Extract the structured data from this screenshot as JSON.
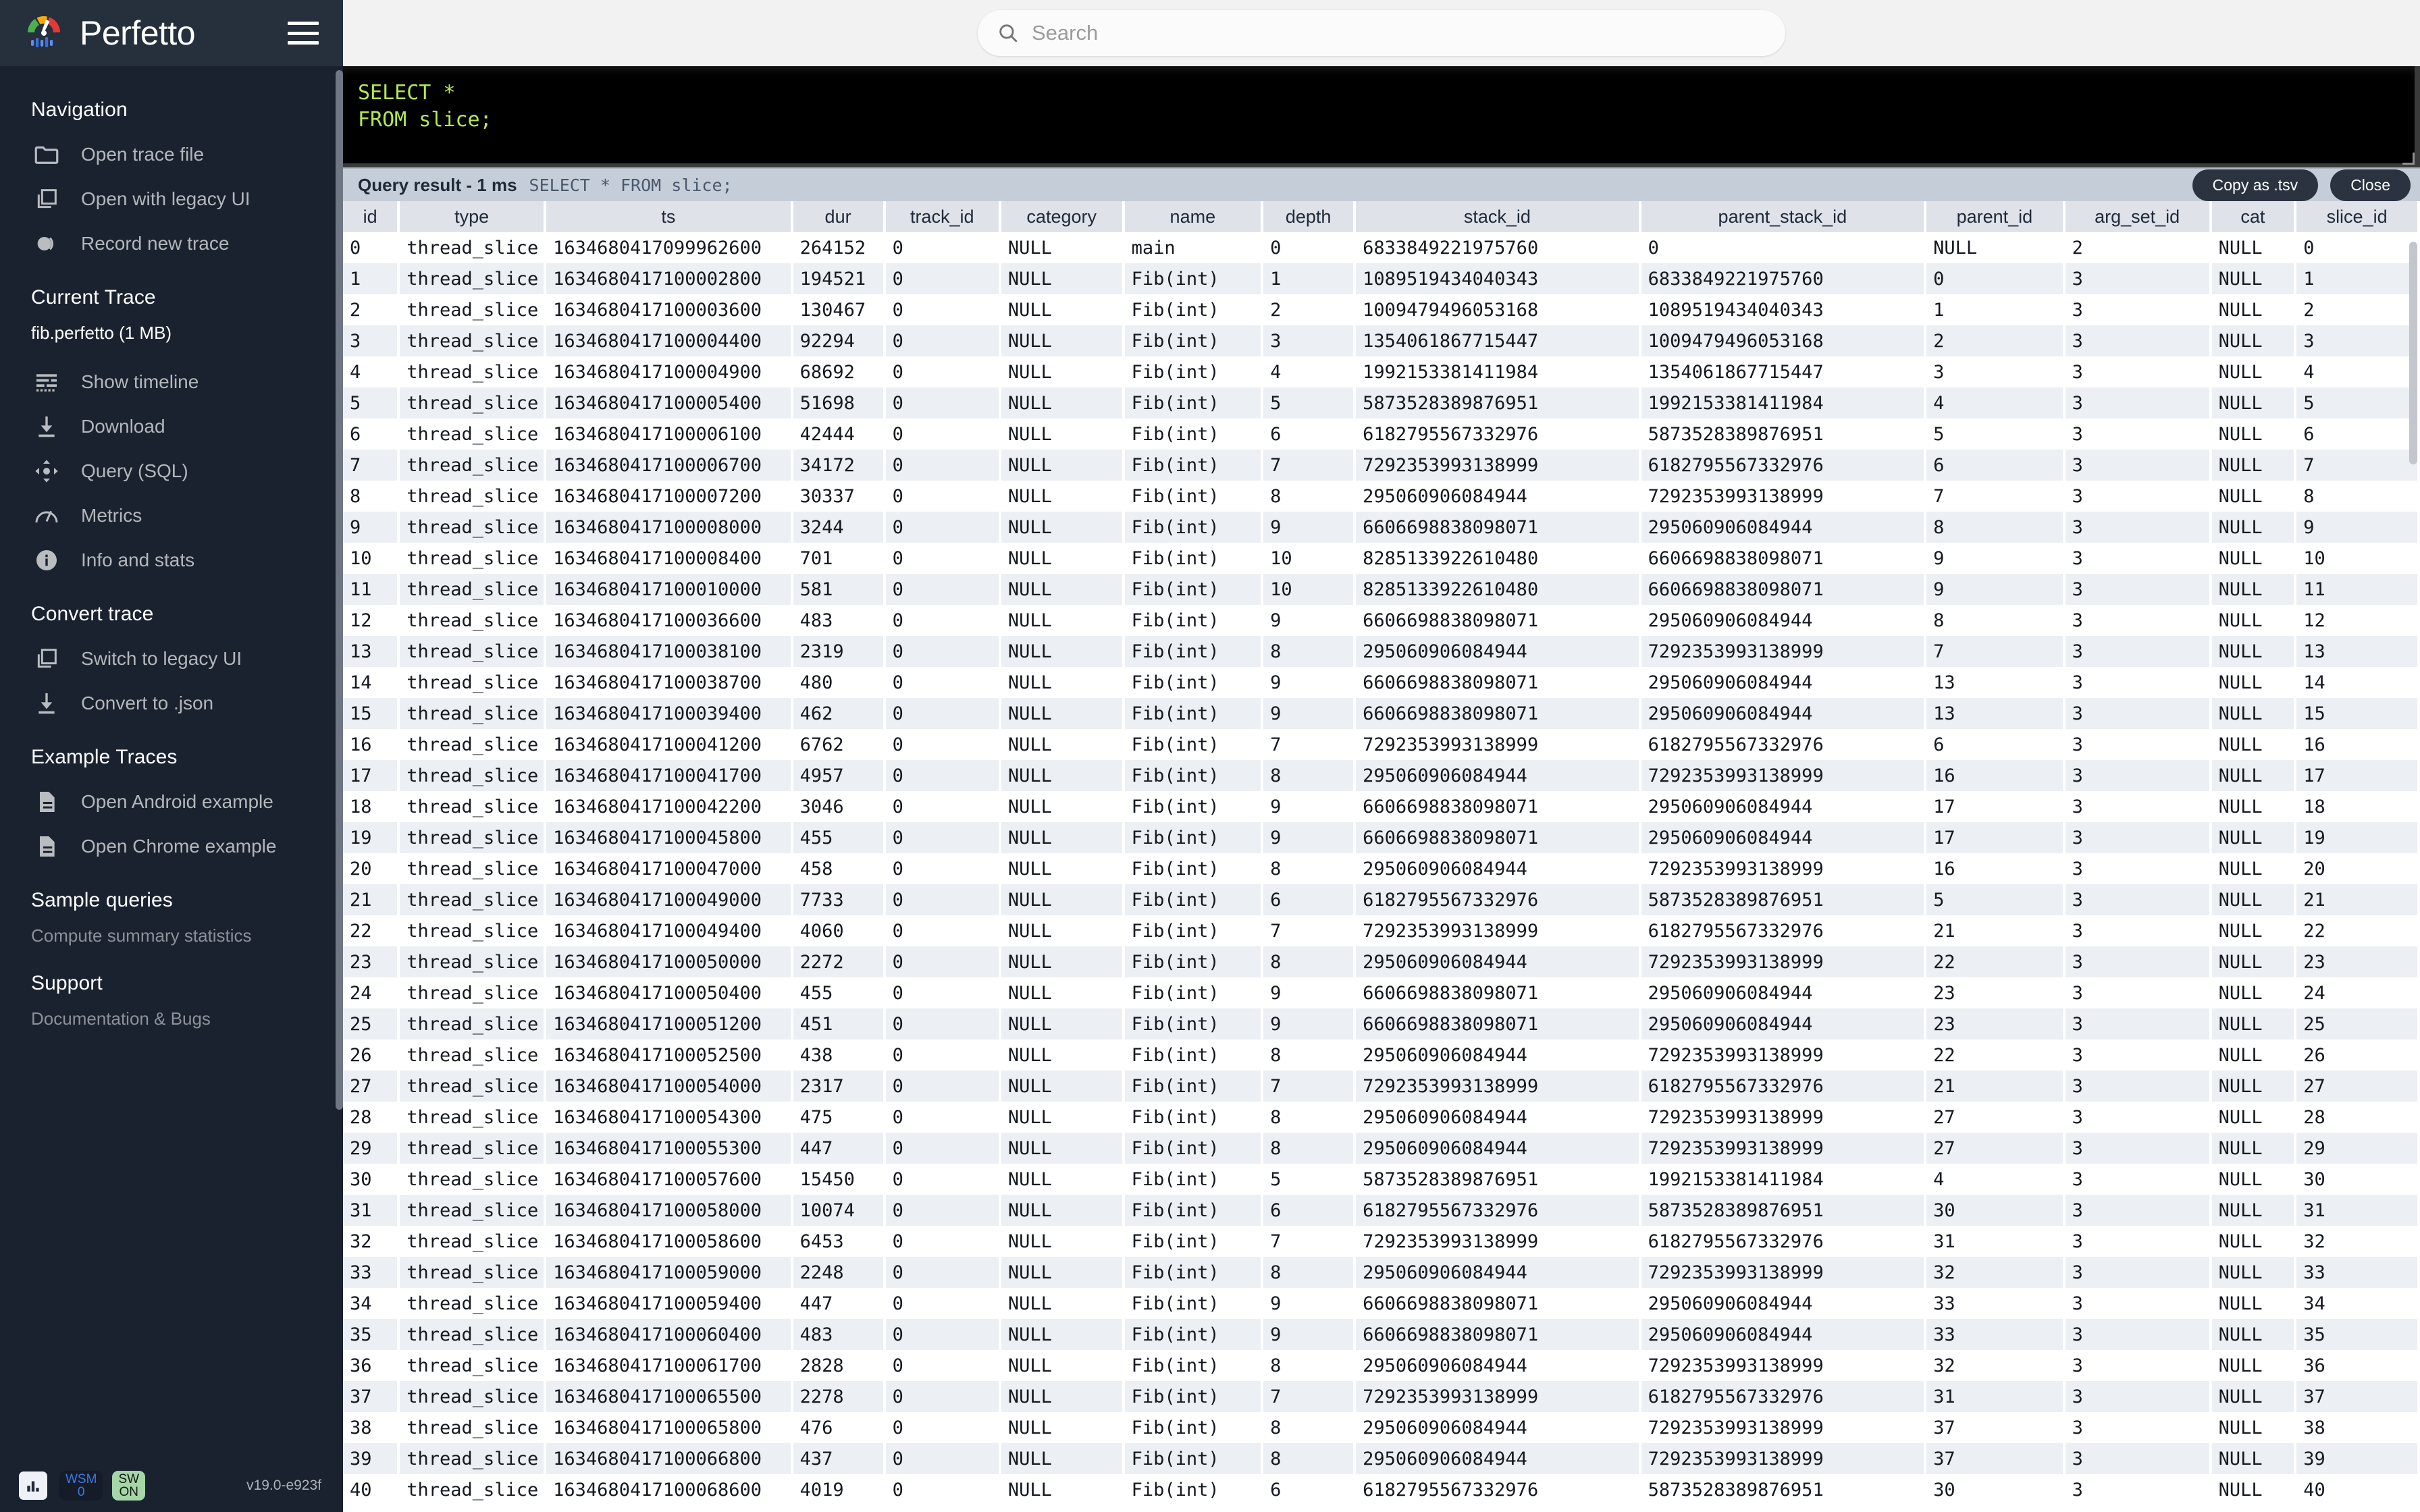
{
  "brand": {
    "title": "Perfetto",
    "logo_icon": "perfetto-logo",
    "menu_icon": "hamburger-icon"
  },
  "search": {
    "placeholder": "Search",
    "value": "",
    "icon": "search-icon"
  },
  "sidebar": {
    "sections": [
      {
        "title": "Navigation",
        "items": [
          {
            "label": "Open trace file",
            "icon": "folder-icon"
          },
          {
            "label": "Open with legacy UI",
            "icon": "copy-icon"
          },
          {
            "label": "Record new trace",
            "icon": "record-icon"
          }
        ]
      },
      {
        "title": "Current Trace",
        "trace_file": "fib.perfetto (1 MB)",
        "items": [
          {
            "label": "Show timeline",
            "icon": "timeline-icon"
          },
          {
            "label": "Download",
            "icon": "download-icon"
          },
          {
            "label": "Query (SQL)",
            "icon": "query-sql-icon"
          },
          {
            "label": "Metrics",
            "icon": "speedometer-icon"
          },
          {
            "label": "Info and stats",
            "icon": "info-icon"
          }
        ]
      },
      {
        "title": "Convert trace",
        "items": [
          {
            "label": "Switch to legacy UI",
            "icon": "copy-icon"
          },
          {
            "label": "Convert to .json",
            "icon": "download-icon"
          }
        ]
      },
      {
        "title": "Example Traces",
        "items": [
          {
            "label": "Open Android example",
            "icon": "document-icon"
          },
          {
            "label": "Open Chrome example",
            "icon": "document-icon"
          }
        ]
      },
      {
        "title": "Sample queries",
        "links": [
          "Compute summary statistics"
        ]
      },
      {
        "title": "Support",
        "links": [
          "Documentation & Bugs"
        ]
      }
    ],
    "footer": {
      "chart_icon": "bar-chart-icon",
      "wsm_label": "WSM",
      "wsm_value": "0",
      "sw_label": "SW",
      "sw_value": "ON",
      "version": "v19.0-e923f"
    }
  },
  "editor": {
    "sql": "SELECT *\nFROM slice;"
  },
  "query_result": {
    "title": "Query result - 1 ms",
    "query": "SELECT * FROM slice;",
    "copy_label": "Copy as .tsv",
    "close_label": "Close"
  },
  "table": {
    "columns": [
      "id",
      "type",
      "ts",
      "dur",
      "track_id",
      "category",
      "name",
      "depth",
      "stack_id",
      "parent_stack_id",
      "parent_id",
      "arg_set_id",
      "cat",
      "slice_id"
    ],
    "rows": [
      [
        "0",
        "thread_slice",
        "1634680417099962600",
        "264152",
        "0",
        "NULL",
        "main",
        "0",
        "6833849221975760",
        "0",
        "NULL",
        "2",
        "NULL",
        "0"
      ],
      [
        "1",
        "thread_slice",
        "1634680417100002800",
        "194521",
        "0",
        "NULL",
        "Fib(int)",
        "1",
        "1089519434040343",
        "6833849221975760",
        "0",
        "3",
        "NULL",
        "1"
      ],
      [
        "2",
        "thread_slice",
        "1634680417100003600",
        "130467",
        "0",
        "NULL",
        "Fib(int)",
        "2",
        "1009479496053168",
        "1089519434040343",
        "1",
        "3",
        "NULL",
        "2"
      ],
      [
        "3",
        "thread_slice",
        "1634680417100004400",
        "92294",
        "0",
        "NULL",
        "Fib(int)",
        "3",
        "1354061867715447",
        "1009479496053168",
        "2",
        "3",
        "NULL",
        "3"
      ],
      [
        "4",
        "thread_slice",
        "1634680417100004900",
        "68692",
        "0",
        "NULL",
        "Fib(int)",
        "4",
        "1992153381411984",
        "1354061867715447",
        "3",
        "3",
        "NULL",
        "4"
      ],
      [
        "5",
        "thread_slice",
        "1634680417100005400",
        "51698",
        "0",
        "NULL",
        "Fib(int)",
        "5",
        "5873528389876951",
        "1992153381411984",
        "4",
        "3",
        "NULL",
        "5"
      ],
      [
        "6",
        "thread_slice",
        "1634680417100006100",
        "42444",
        "0",
        "NULL",
        "Fib(int)",
        "6",
        "6182795567332976",
        "5873528389876951",
        "5",
        "3",
        "NULL",
        "6"
      ],
      [
        "7",
        "thread_slice",
        "1634680417100006700",
        "34172",
        "0",
        "NULL",
        "Fib(int)",
        "7",
        "7292353993138999",
        "6182795567332976",
        "6",
        "3",
        "NULL",
        "7"
      ],
      [
        "8",
        "thread_slice",
        "1634680417100007200",
        "30337",
        "0",
        "NULL",
        "Fib(int)",
        "8",
        "295060906084944",
        "7292353993138999",
        "7",
        "3",
        "NULL",
        "8"
      ],
      [
        "9",
        "thread_slice",
        "1634680417100008000",
        "3244",
        "0",
        "NULL",
        "Fib(int)",
        "9",
        "6606698838098071",
        "295060906084944",
        "8",
        "3",
        "NULL",
        "9"
      ],
      [
        "10",
        "thread_slice",
        "1634680417100008400",
        "701",
        "0",
        "NULL",
        "Fib(int)",
        "10",
        "8285133922610480",
        "6606698838098071",
        "9",
        "3",
        "NULL",
        "10"
      ],
      [
        "11",
        "thread_slice",
        "1634680417100010000",
        "581",
        "0",
        "NULL",
        "Fib(int)",
        "10",
        "8285133922610480",
        "6606698838098071",
        "9",
        "3",
        "NULL",
        "11"
      ],
      [
        "12",
        "thread_slice",
        "1634680417100036600",
        "483",
        "0",
        "NULL",
        "Fib(int)",
        "9",
        "6606698838098071",
        "295060906084944",
        "8",
        "3",
        "NULL",
        "12"
      ],
      [
        "13",
        "thread_slice",
        "1634680417100038100",
        "2319",
        "0",
        "NULL",
        "Fib(int)",
        "8",
        "295060906084944",
        "7292353993138999",
        "7",
        "3",
        "NULL",
        "13"
      ],
      [
        "14",
        "thread_slice",
        "1634680417100038700",
        "480",
        "0",
        "NULL",
        "Fib(int)",
        "9",
        "6606698838098071",
        "295060906084944",
        "13",
        "3",
        "NULL",
        "14"
      ],
      [
        "15",
        "thread_slice",
        "1634680417100039400",
        "462",
        "0",
        "NULL",
        "Fib(int)",
        "9",
        "6606698838098071",
        "295060906084944",
        "13",
        "3",
        "NULL",
        "15"
      ],
      [
        "16",
        "thread_slice",
        "1634680417100041200",
        "6762",
        "0",
        "NULL",
        "Fib(int)",
        "7",
        "7292353993138999",
        "6182795567332976",
        "6",
        "3",
        "NULL",
        "16"
      ],
      [
        "17",
        "thread_slice",
        "1634680417100041700",
        "4957",
        "0",
        "NULL",
        "Fib(int)",
        "8",
        "295060906084944",
        "7292353993138999",
        "16",
        "3",
        "NULL",
        "17"
      ],
      [
        "18",
        "thread_slice",
        "1634680417100042200",
        "3046",
        "0",
        "NULL",
        "Fib(int)",
        "9",
        "6606698838098071",
        "295060906084944",
        "17",
        "3",
        "NULL",
        "18"
      ],
      [
        "19",
        "thread_slice",
        "1634680417100045800",
        "455",
        "0",
        "NULL",
        "Fib(int)",
        "9",
        "6606698838098071",
        "295060906084944",
        "17",
        "3",
        "NULL",
        "19"
      ],
      [
        "20",
        "thread_slice",
        "1634680417100047000",
        "458",
        "0",
        "NULL",
        "Fib(int)",
        "8",
        "295060906084944",
        "7292353993138999",
        "16",
        "3",
        "NULL",
        "20"
      ],
      [
        "21",
        "thread_slice",
        "1634680417100049000",
        "7733",
        "0",
        "NULL",
        "Fib(int)",
        "6",
        "6182795567332976",
        "5873528389876951",
        "5",
        "3",
        "NULL",
        "21"
      ],
      [
        "22",
        "thread_slice",
        "1634680417100049400",
        "4060",
        "0",
        "NULL",
        "Fib(int)",
        "7",
        "7292353993138999",
        "6182795567332976",
        "21",
        "3",
        "NULL",
        "22"
      ],
      [
        "23",
        "thread_slice",
        "1634680417100050000",
        "2272",
        "0",
        "NULL",
        "Fib(int)",
        "8",
        "295060906084944",
        "7292353993138999",
        "22",
        "3",
        "NULL",
        "23"
      ],
      [
        "24",
        "thread_slice",
        "1634680417100050400",
        "455",
        "0",
        "NULL",
        "Fib(int)",
        "9",
        "6606698838098071",
        "295060906084944",
        "23",
        "3",
        "NULL",
        "24"
      ],
      [
        "25",
        "thread_slice",
        "1634680417100051200",
        "451",
        "0",
        "NULL",
        "Fib(int)",
        "9",
        "6606698838098071",
        "295060906084944",
        "23",
        "3",
        "NULL",
        "25"
      ],
      [
        "26",
        "thread_slice",
        "1634680417100052500",
        "438",
        "0",
        "NULL",
        "Fib(int)",
        "8",
        "295060906084944",
        "7292353993138999",
        "22",
        "3",
        "NULL",
        "26"
      ],
      [
        "27",
        "thread_slice",
        "1634680417100054000",
        "2317",
        "0",
        "NULL",
        "Fib(int)",
        "7",
        "7292353993138999",
        "6182795567332976",
        "21",
        "3",
        "NULL",
        "27"
      ],
      [
        "28",
        "thread_slice",
        "1634680417100054300",
        "475",
        "0",
        "NULL",
        "Fib(int)",
        "8",
        "295060906084944",
        "7292353993138999",
        "27",
        "3",
        "NULL",
        "28"
      ],
      [
        "29",
        "thread_slice",
        "1634680417100055300",
        "447",
        "0",
        "NULL",
        "Fib(int)",
        "8",
        "295060906084944",
        "7292353993138999",
        "27",
        "3",
        "NULL",
        "29"
      ],
      [
        "30",
        "thread_slice",
        "1634680417100057600",
        "15450",
        "0",
        "NULL",
        "Fib(int)",
        "5",
        "5873528389876951",
        "1992153381411984",
        "4",
        "3",
        "NULL",
        "30"
      ],
      [
        "31",
        "thread_slice",
        "1634680417100058000",
        "10074",
        "0",
        "NULL",
        "Fib(int)",
        "6",
        "6182795567332976",
        "5873528389876951",
        "30",
        "3",
        "NULL",
        "31"
      ],
      [
        "32",
        "thread_slice",
        "1634680417100058600",
        "6453",
        "0",
        "NULL",
        "Fib(int)",
        "7",
        "7292353993138999",
        "6182795567332976",
        "31",
        "3",
        "NULL",
        "32"
      ],
      [
        "33",
        "thread_slice",
        "1634680417100059000",
        "2248",
        "0",
        "NULL",
        "Fib(int)",
        "8",
        "295060906084944",
        "7292353993138999",
        "32",
        "3",
        "NULL",
        "33"
      ],
      [
        "34",
        "thread_slice",
        "1634680417100059400",
        "447",
        "0",
        "NULL",
        "Fib(int)",
        "9",
        "6606698838098071",
        "295060906084944",
        "33",
        "3",
        "NULL",
        "34"
      ],
      [
        "35",
        "thread_slice",
        "1634680417100060400",
        "483",
        "0",
        "NULL",
        "Fib(int)",
        "9",
        "6606698838098071",
        "295060906084944",
        "33",
        "3",
        "NULL",
        "35"
      ],
      [
        "36",
        "thread_slice",
        "1634680417100061700",
        "2828",
        "0",
        "NULL",
        "Fib(int)",
        "8",
        "295060906084944",
        "7292353993138999",
        "32",
        "3",
        "NULL",
        "36"
      ],
      [
        "37",
        "thread_slice",
        "1634680417100065500",
        "2278",
        "0",
        "NULL",
        "Fib(int)",
        "7",
        "7292353993138999",
        "6182795567332976",
        "31",
        "3",
        "NULL",
        "37"
      ],
      [
        "38",
        "thread_slice",
        "1634680417100065800",
        "476",
        "0",
        "NULL",
        "Fib(int)",
        "8",
        "295060906084944",
        "7292353993138999",
        "37",
        "3",
        "NULL",
        "38"
      ],
      [
        "39",
        "thread_slice",
        "1634680417100066800",
        "437",
        "0",
        "NULL",
        "Fib(int)",
        "8",
        "295060906084944",
        "7292353993138999",
        "37",
        "3",
        "NULL",
        "39"
      ],
      [
        "40",
        "thread_slice",
        "1634680417100068600",
        "4019",
        "0",
        "NULL",
        "Fib(int)",
        "6",
        "6182795567332976",
        "5873528389876951",
        "30",
        "3",
        "NULL",
        "40"
      ]
    ]
  }
}
